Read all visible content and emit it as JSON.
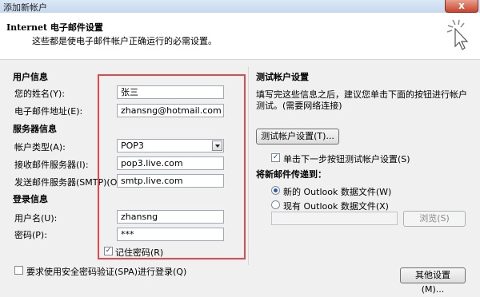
{
  "window": {
    "title": "添加新帐户",
    "close_label": "x"
  },
  "header": {
    "title": "Internet 电子邮件设置",
    "subtitle": "这些都是使电子邮件帐户正确运行的必需设置。",
    "icon": "cursor-click-icon"
  },
  "user_info": {
    "heading": "用户信息",
    "name_label": "您的姓名(Y):",
    "name_value": "张三",
    "email_label": "电子邮件地址(E):",
    "email_value": "zhansng@hotmail.com"
  },
  "server_info": {
    "heading": "服务器信息",
    "account_type_label": "帐户类型(A):",
    "account_type_value": "POP3",
    "incoming_label": "接收邮件服务器(I):",
    "incoming_value": "pop3.live.com",
    "outgoing_label": "发送邮件服务器(SMTP)(O):",
    "outgoing_value": "smtp.live.com"
  },
  "login_info": {
    "heading": "登录信息",
    "username_label": "用户名(U):",
    "username_value": "zhansng",
    "password_label": "密码(P):",
    "password_value": "***",
    "remember_label": "记住密码(R)",
    "remember_checked": true
  },
  "spa": {
    "label": "要求使用安全密码验证(SPA)进行登录(Q)",
    "checked": false
  },
  "test": {
    "heading": "测试帐户设置",
    "description_line1": "填写完这些信息之后，建议您单击下面的按钮进行帐户",
    "description_line2": "测试。(需要网络连接)",
    "test_button": "测试帐户设置(T)...",
    "auto_test_label": "单击下一步按钮测试帐户设置(S)",
    "auto_test_checked": true
  },
  "deliver": {
    "heading": "将新邮件传递到：",
    "new_file_label": "新的 Outlook 数据文件(W)",
    "existing_file_label": "现有 Outlook 数据文件(X)",
    "selected": "new",
    "browse_button": "浏览(S)"
  },
  "more_settings_button": "其他设置(M)...",
  "colors": {
    "highlight_box": "#e04a4a",
    "accent": "#1f5fb0"
  }
}
